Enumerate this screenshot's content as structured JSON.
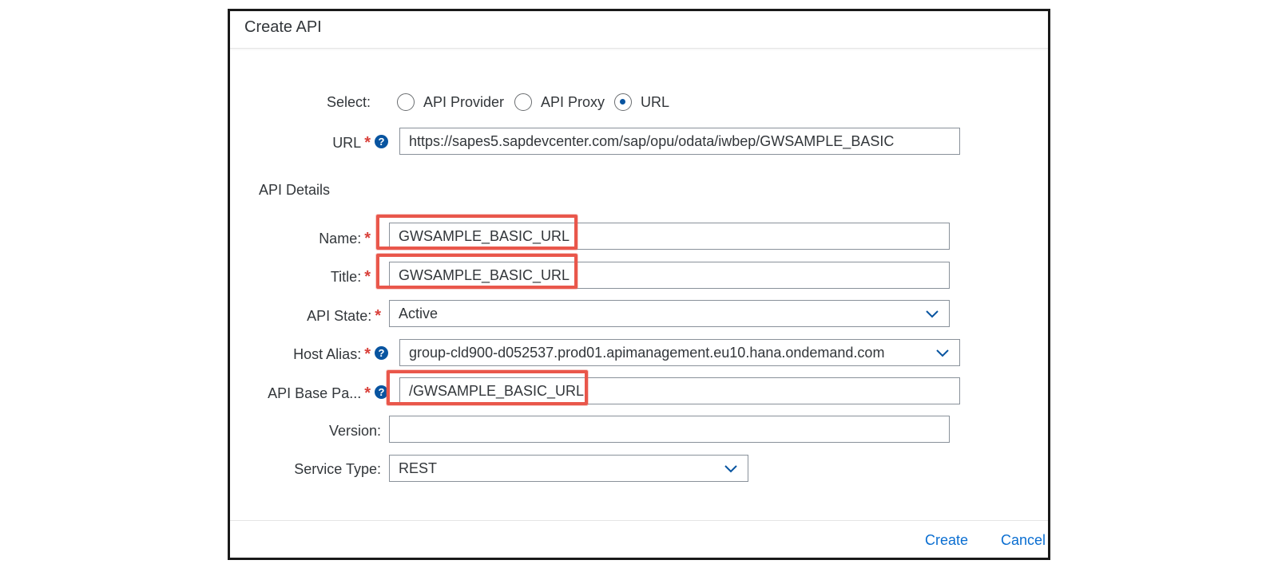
{
  "dialog": {
    "title": "Create API"
  },
  "select": {
    "label": "Select:",
    "options": [
      "API Provider",
      "API Proxy",
      "URL"
    ],
    "selected": "URL"
  },
  "url": {
    "label": "URL",
    "value": "https://sapes5.sapdevcenter.com/sap/opu/odata/iwbep/GWSAMPLE_BASIC"
  },
  "details": {
    "heading": "API Details",
    "name": {
      "label": "Name:",
      "value": "GWSAMPLE_BASIC_URL"
    },
    "title": {
      "label": "Title:",
      "value": "GWSAMPLE_BASIC_URL"
    },
    "state": {
      "label": "API State:",
      "value": "Active"
    },
    "host": {
      "label": "Host Alias:",
      "value": "group-cld900-d052537.prod01.apimanagement.eu10.hana.ondemand.com"
    },
    "base_path": {
      "label": "API Base Pa...",
      "value": "/GWSAMPLE_BASIC_URL"
    },
    "version": {
      "label": "Version:",
      "value": ""
    },
    "service_type": {
      "label": "Service Type:",
      "value": "REST"
    }
  },
  "required_mark": "*",
  "help_glyph": "?",
  "footer": {
    "create_label": "Create",
    "cancel_label": "Cancel"
  },
  "colors": {
    "accent": "#0a6ed1",
    "required": "#d9413b",
    "highlight": "#e9574b"
  }
}
